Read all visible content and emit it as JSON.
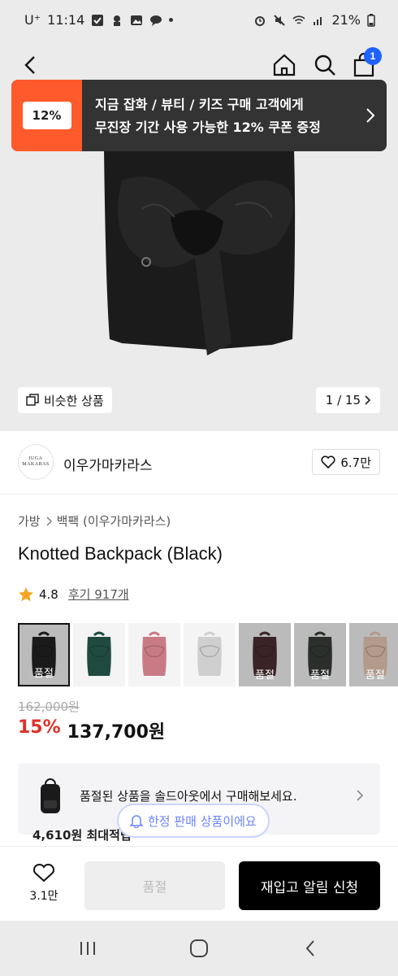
{
  "status_bar": {
    "carrier": "U⁺",
    "time": "11:14",
    "battery": "21%"
  },
  "coupon": {
    "badge": "12%",
    "line1": "지금 잡화 / 뷰티 / 키즈 구매 고객에게",
    "line2": "무진장 기간 사용 가능한 12% 쿠폰 증정"
  },
  "nav": {
    "cart_count": "1"
  },
  "hero": {
    "similar_label": "비슷한 상품",
    "page_indicator": "1 / 15"
  },
  "brand": {
    "logo_line1": "IUGA",
    "logo_line2": "MAKARAS",
    "name": "이우가마카라스",
    "likes": "6.7만"
  },
  "breadcrumb": {
    "category": "가방",
    "subcategory": "백팩 (이우가마카라스)"
  },
  "product": {
    "name": "Knotted Backpack (Black)",
    "rating": "4.8",
    "review_label": "후기 917개",
    "original_price": "162,000원",
    "discount": "15%",
    "price": "137,700원"
  },
  "thumbnails": [
    {
      "color": "#1a1a1a",
      "label": "품절",
      "soldout": true
    },
    {
      "color": "#1f4a40",
      "label": "",
      "soldout": false
    },
    {
      "color": "#c97b85",
      "label": "",
      "soldout": false
    },
    {
      "color": "#cfcfcf",
      "label": "",
      "soldout": false
    },
    {
      "color": "#3a2326",
      "label": "품절",
      "soldout": true
    },
    {
      "color": "#2a2f2a",
      "label": "품절",
      "soldout": true
    },
    {
      "color": "#b29a8c",
      "label": "품절",
      "soldout": true
    }
  ],
  "soldout_notice": {
    "text": "품절된 상품을 솔드아웃에서 구매해보세요.",
    "points": "4,610원 최대적립"
  },
  "limited_badge": "한정 판매 상품이에요",
  "actions": {
    "wish_count": "3.1만",
    "soldout_label": "품절",
    "restock_label": "재입고 알림 신청"
  }
}
